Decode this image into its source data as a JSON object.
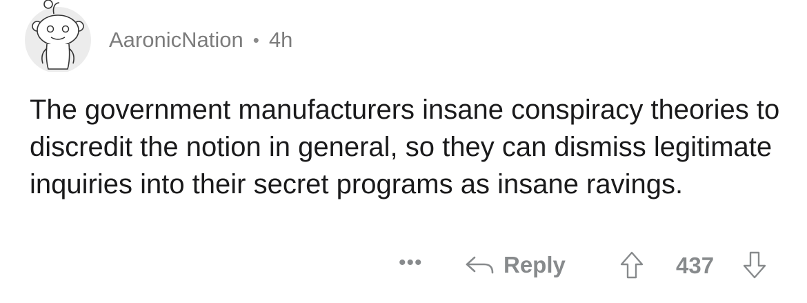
{
  "comment": {
    "avatar_icon": "reddit-snoo-avatar-icon",
    "author": "AaronicNation",
    "separator": "•",
    "age": "4h",
    "body": "The government manufacturers insane conspiracy theories to discredit the notion in general, so they can dismiss legitimate inquiries into their secret programs as insane ravings."
  },
  "actions": {
    "more_label": "•••",
    "more_icon": "more-options-icon",
    "reply_icon": "reply-arrow-icon",
    "reply_label": "Reply",
    "upvote_icon": "upvote-arrow-icon",
    "score": "437",
    "downvote_icon": "downvote-arrow-icon"
  },
  "colors": {
    "text": "#1a1a1b",
    "meta": "#7c7c7c",
    "action": "#878a8c",
    "background": "#ffffff"
  }
}
